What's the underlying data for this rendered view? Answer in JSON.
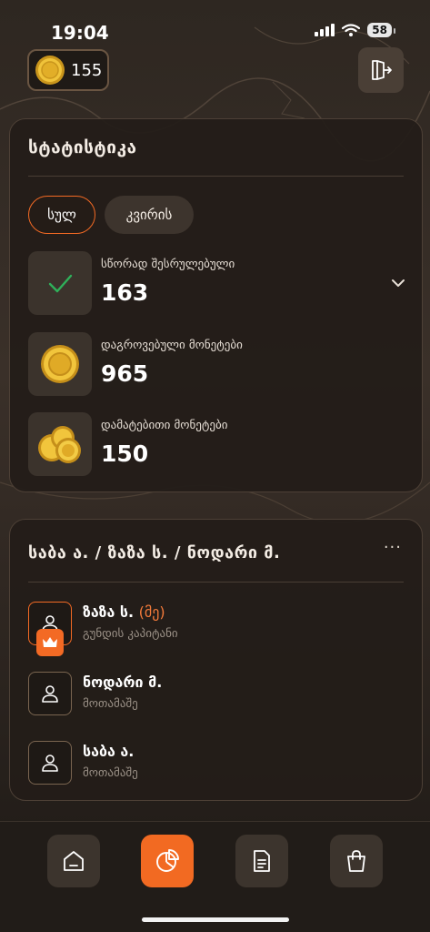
{
  "status_bar": {
    "time": "19:04",
    "battery": "58"
  },
  "header": {
    "coin_balance": "155"
  },
  "stats": {
    "title": "სტატისტიკა",
    "tabs": [
      {
        "label": "სულ",
        "selected": true
      },
      {
        "label": "კვირის",
        "selected": false
      }
    ],
    "rows": [
      {
        "label": "სწორად შესრულებული",
        "value": "163",
        "icon": "checkmark-icon"
      },
      {
        "label": "დაგროვებული მონეტები",
        "value": "965",
        "icon": "coin-icon"
      },
      {
        "label": "დამატებითი მონეტები",
        "value": "150",
        "icon": "coins-stack-icon"
      }
    ]
  },
  "team": {
    "title": "საბა ა. / ზაზა ს. / ნოდარი მ.",
    "more": "···",
    "members": [
      {
        "name": "ზაზა ს.",
        "me": "(მე)",
        "role": "გუნდის კაპიტანი",
        "captain": true
      },
      {
        "name": "ნოდარი მ.",
        "role": "მოთამაშე",
        "captain": false
      },
      {
        "name": "საბა ა.",
        "role": "მოთამაშე",
        "captain": false
      }
    ]
  },
  "nav": [
    {
      "icon": "home-icon",
      "active": false
    },
    {
      "icon": "pie-chart-icon",
      "active": true
    },
    {
      "icon": "document-icon",
      "active": false
    },
    {
      "icon": "shopping-bag-icon",
      "active": false
    }
  ],
  "colors": {
    "accent": "#f26a22",
    "check_green": "#2fb05a",
    "coin_gold": "#e8b92c"
  }
}
